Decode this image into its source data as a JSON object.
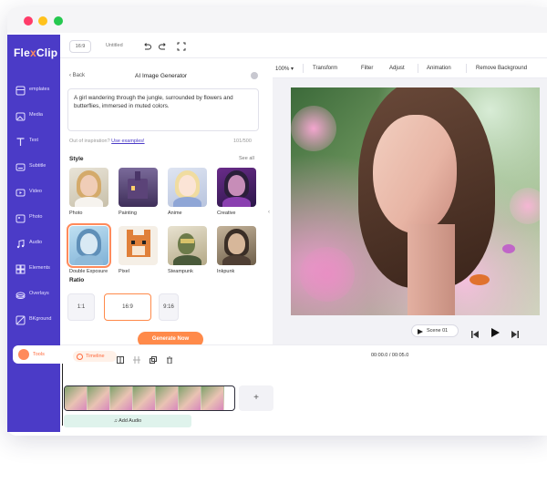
{
  "window": {
    "dot_colors": [
      "#ff3b69",
      "#ffc21d",
      "#25c84f"
    ]
  },
  "brand": {
    "name_a": "Fle",
    "name_b": "x",
    "name_c": "Clip",
    "accent": "#4b3bc7",
    "orange": "#ff8a4a"
  },
  "sidebar": {
    "items": [
      {
        "label": "emplates",
        "icon": "templates-icon"
      },
      {
        "label": "Media",
        "icon": "media-icon"
      },
      {
        "label": "Text",
        "icon": "text-icon"
      },
      {
        "label": "Subtitle",
        "icon": "subtitle-icon"
      },
      {
        "label": "Video",
        "icon": "video-icon"
      },
      {
        "label": "Photo",
        "icon": "photo-icon"
      },
      {
        "label": "Audio",
        "icon": "audio-icon"
      },
      {
        "label": "Elements",
        "icon": "elements-icon"
      },
      {
        "label": "Overlays",
        "icon": "overlays-icon"
      },
      {
        "label": "BKground",
        "icon": "background-icon"
      }
    ],
    "active_label": "Tools"
  },
  "topbar": {
    "ratio": "16:9",
    "title": "Untitled"
  },
  "panel": {
    "back": "Back",
    "title": "AI Image Generator",
    "prompt": "A girl wandering through the jungle, surrounded by flowers and butterflies, immersed in muted colors.",
    "inspo_text": "Out of inspiration?",
    "inspo_link": "Use examples!",
    "counter": "101/500",
    "style_heading": "Style",
    "see_all": "See all",
    "styles": [
      {
        "label": "Photo"
      },
      {
        "label": "Painting"
      },
      {
        "label": "Anime"
      },
      {
        "label": "Creative"
      },
      {
        "label": "Double Exposure"
      },
      {
        "label": "Pixel"
      },
      {
        "label": "Steampunk"
      },
      {
        "label": "Inkpunk"
      }
    ],
    "selected_style": "Double Exposure",
    "ratio_heading": "Ratio",
    "ratios": [
      "1:1",
      "16:9",
      "9:16"
    ],
    "selected_ratio": "16:9",
    "generate": "Generate Now"
  },
  "canvas_toolbar": {
    "zoom": "100%",
    "items": [
      "Transform",
      "Filter",
      "Adjust",
      "Animation",
      "Remove Background"
    ]
  },
  "player": {
    "scene": "Scene 01"
  },
  "timeline": {
    "label": "Timeline",
    "time": "00:00.0 / 00:05.0",
    "add_audio": "Add Audio"
  }
}
